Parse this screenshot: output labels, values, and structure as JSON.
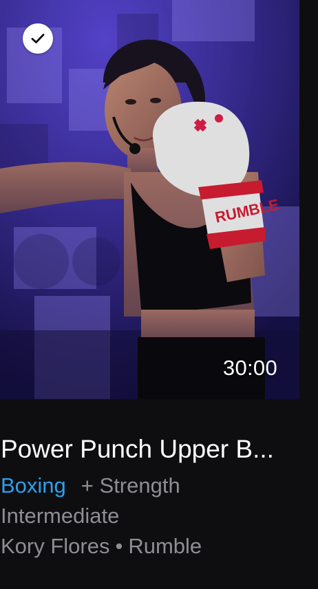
{
  "workout": {
    "duration": "30:00",
    "completed": true,
    "title": "Power Punch Upper B...",
    "category": "Boxing",
    "secondary_category": "+ Strength",
    "level": "Intermediate",
    "instructor": "Kory Flores",
    "separator": "•",
    "studio": "Rumble",
    "glove_text": "RUMBLE"
  },
  "icons": {
    "completed_badge": "checkmark-icon"
  },
  "colors": {
    "background": "#0e0e10",
    "title": "#ffffff",
    "category_accent": "#2aa2f0",
    "meta_text": "#8e8e93",
    "thumbnail_tint": "#2a2270"
  }
}
